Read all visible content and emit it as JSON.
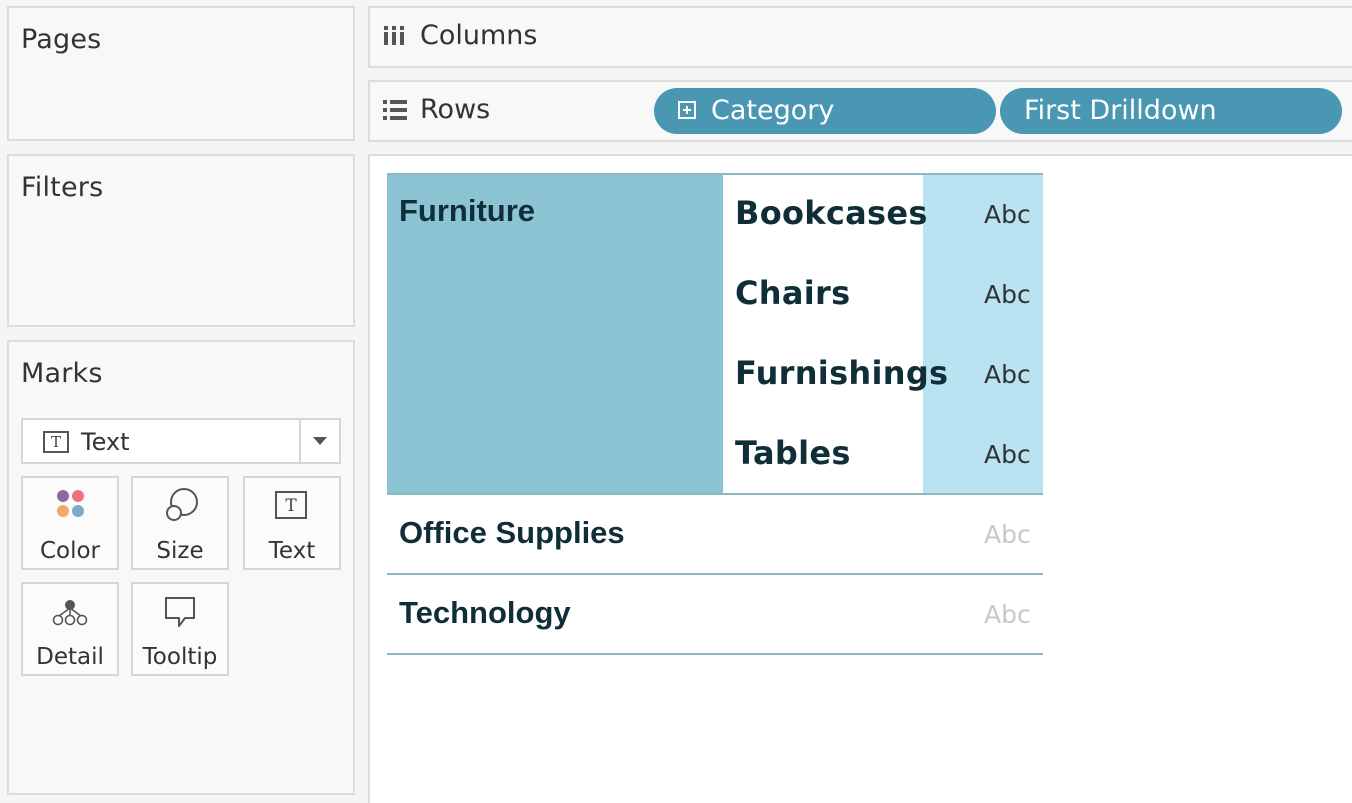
{
  "panels": {
    "pages": "Pages",
    "filters": "Filters",
    "marks": "Marks"
  },
  "marks": {
    "type_value": "Text",
    "type_icon": "text-mark-icon",
    "buttons": {
      "color": "Color",
      "size": "Size",
      "text": "Text",
      "detail": "Detail",
      "tooltip": "Tooltip"
    },
    "color_dots": [
      "#8b6aa3",
      "#f07080",
      "#f2a86a",
      "#7fa9c9"
    ]
  },
  "shelves": {
    "columns_label": "Columns",
    "rows_label": "Rows",
    "row_pills": [
      {
        "label": "Category",
        "expand_icon": "plus-box-icon"
      },
      {
        "label": "First Drilldown"
      }
    ],
    "pill_color": "#4a97b4"
  },
  "view": {
    "categories": [
      {
        "name": "Furniture",
        "expanded": true,
        "subcategories": [
          {
            "name": "Bookcases",
            "value": "Abc"
          },
          {
            "name": "Chairs",
            "value": "Abc"
          },
          {
            "name": "Furnishings",
            "value": "Abc"
          },
          {
            "name": "Tables",
            "value": "Abc"
          }
        ]
      },
      {
        "name": "Office Supplies",
        "expanded": false,
        "value": "Abc"
      },
      {
        "name": "Technology",
        "expanded": false,
        "value": "Abc"
      }
    ],
    "colors": {
      "category_highlight": "#8bc3d3",
      "value_highlight": "#bae3f1",
      "text": "#0f2e38",
      "divider": "#8ab9c4"
    }
  }
}
